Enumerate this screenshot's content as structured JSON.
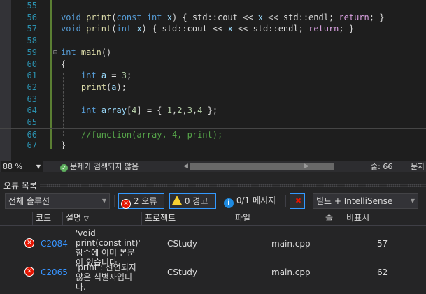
{
  "editor": {
    "lines": [
      {
        "n": "55",
        "tokens": []
      },
      {
        "n": "56",
        "tokens": [
          [
            "void ",
            "kw"
          ],
          [
            "print",
            "fn"
          ],
          [
            "(",
            "tx"
          ],
          [
            "const int ",
            "kw"
          ],
          [
            "x",
            "pm"
          ],
          [
            ") { std::cout << ",
            "tx"
          ],
          [
            "x",
            "pm"
          ],
          [
            " << std::endl; ",
            "tx"
          ],
          [
            "return",
            "ctl"
          ],
          [
            "; }",
            "tx"
          ]
        ]
      },
      {
        "n": "57",
        "tokens": [
          [
            "void ",
            "kw"
          ],
          [
            "print",
            "fn"
          ],
          [
            "(",
            "tx"
          ],
          [
            "int ",
            "kw"
          ],
          [
            "x",
            "pm"
          ],
          [
            ") { std::cout << ",
            "tx"
          ],
          [
            "x",
            "pm"
          ],
          [
            " << std::endl; ",
            "tx"
          ],
          [
            "return",
            "ctl"
          ],
          [
            "; }",
            "tx"
          ]
        ]
      },
      {
        "n": "58",
        "tokens": []
      },
      {
        "n": "59",
        "tokens": [
          [
            "int ",
            "kw"
          ],
          [
            "main",
            "fn"
          ],
          [
            "()",
            "tx"
          ]
        ]
      },
      {
        "n": "60",
        "tokens": [
          [
            "{",
            "tx"
          ]
        ]
      },
      {
        "n": "61",
        "tokens": [
          [
            "    ",
            "tx"
          ],
          [
            "int ",
            "kw"
          ],
          [
            "a",
            "pm"
          ],
          [
            " = ",
            "tx"
          ],
          [
            "3",
            "nu"
          ],
          [
            ";",
            "tx"
          ]
        ]
      },
      {
        "n": "62",
        "tokens": [
          [
            "    ",
            "tx"
          ],
          [
            "print",
            "fn"
          ],
          [
            "(",
            "tx"
          ],
          [
            "a",
            "pm"
          ],
          [
            ");",
            "tx"
          ]
        ]
      },
      {
        "n": "63",
        "tokens": []
      },
      {
        "n": "64",
        "tokens": [
          [
            "    ",
            "tx"
          ],
          [
            "int ",
            "kw"
          ],
          [
            "array",
            "pm"
          ],
          [
            "[",
            "tx"
          ],
          [
            "4",
            "nu"
          ],
          [
            "] = { ",
            "tx"
          ],
          [
            "1",
            "nu"
          ],
          [
            ",",
            "tx"
          ],
          [
            "2",
            "nu"
          ],
          [
            ",",
            "tx"
          ],
          [
            "3",
            "nu"
          ],
          [
            ",",
            "tx"
          ],
          [
            "4",
            "nu"
          ],
          [
            " };",
            "tx"
          ]
        ]
      },
      {
        "n": "65",
        "tokens": []
      },
      {
        "n": "66",
        "tokens": [
          [
            "    ",
            "tx"
          ],
          [
            "//function(array, 4, print);",
            "cm"
          ]
        ]
      },
      {
        "n": "67",
        "tokens": [
          [
            "}",
            "tx"
          ]
        ]
      }
    ]
  },
  "status": {
    "zoom": "88 %",
    "issues": "문제가 검색되지 않음",
    "line": "줄: 66",
    "col": "문자"
  },
  "error_list": {
    "title": "오류 목록",
    "scope": "전체 솔루션",
    "errors_btn": "2 오류",
    "warnings_btn": "0 경고",
    "messages_btn": "0/1 메시지",
    "source": "빌드 + IntelliSense",
    "columns": {
      "code": "코드",
      "desc": "설명",
      "project": "프로젝트",
      "file": "파일",
      "line": "줄",
      "suppress": "비표시"
    },
    "rows": [
      {
        "code": "C2084",
        "desc": "'void print(const int)' 함수에 이미 본문이 있습니다.",
        "project": "CStudy",
        "file": "main.cpp",
        "line": "57"
      },
      {
        "code": "C2065",
        "desc": "'print': 선언되지 않은 식별자입니다.",
        "project": "CStudy",
        "file": "main.cpp",
        "line": "62"
      }
    ]
  }
}
